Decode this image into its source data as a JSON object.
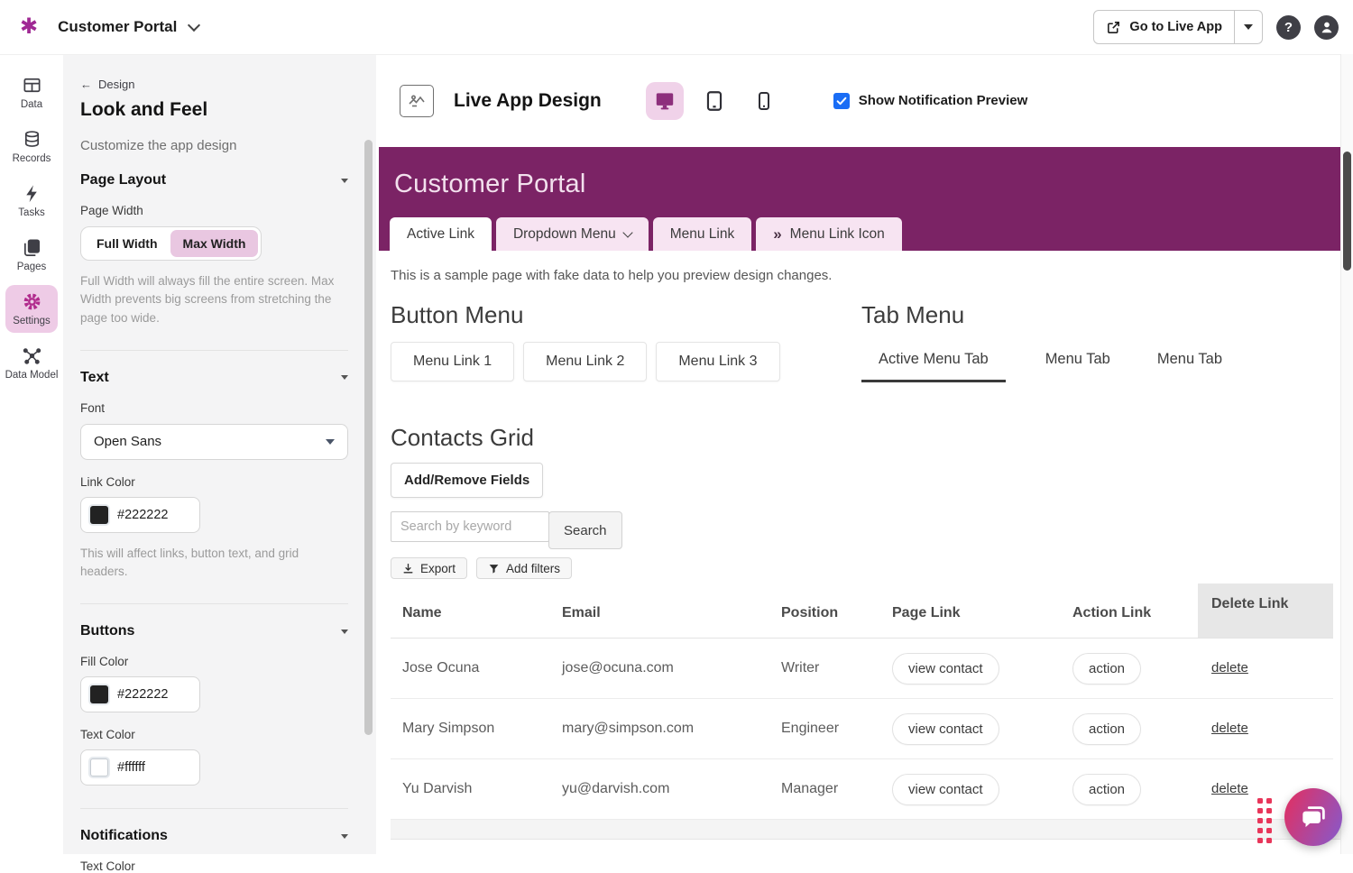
{
  "icons": {
    "logo": "✱",
    "back_arrow": "←",
    "double_chevron": "»",
    "help": "?"
  },
  "topbar": {
    "app_title": "Customer Portal",
    "go_live_label": "Go to Live App"
  },
  "sidebar": {
    "items": [
      {
        "label": "Data"
      },
      {
        "label": "Records"
      },
      {
        "label": "Tasks"
      },
      {
        "label": "Pages"
      },
      {
        "label": "Settings"
      },
      {
        "label": "Data Model"
      }
    ]
  },
  "panel": {
    "back_label": "Design",
    "title": "Look and Feel",
    "subtitle": "Customize the app design",
    "page_layout": {
      "heading": "Page Layout",
      "page_width_label": "Page Width",
      "full_width": "Full Width",
      "max_width": "Max Width",
      "helper": "Full Width will always fill the entire screen. Max Width prevents big screens from stretching the page too wide."
    },
    "text": {
      "heading": "Text",
      "font_label": "Font",
      "font_value": "Open Sans",
      "link_color_label": "Link Color",
      "link_color_value": "#222222",
      "helper": "This will affect links, button text, and grid headers."
    },
    "buttons": {
      "heading": "Buttons",
      "fill_color_label": "Fill Color",
      "fill_color_value": "#222222",
      "text_color_label": "Text Color",
      "text_color_value": "#ffffff"
    },
    "notifications": {
      "heading": "Notifications",
      "text_color_label": "Text Color"
    }
  },
  "main": {
    "title": "Live App Design",
    "notification_label": "Show Notification Preview",
    "preview": {
      "header_title": "Customer Portal",
      "nav_tabs": [
        {
          "label": "Active Link"
        },
        {
          "label": "Dropdown Menu"
        },
        {
          "label": "Menu Link"
        },
        {
          "label": "Menu Link Icon"
        }
      ],
      "sample_text": "This is a sample page with fake data to help you preview design changes.",
      "button_menu_heading": "Button Menu",
      "menu_buttons": [
        {
          "label": "Menu Link 1"
        },
        {
          "label": "Menu Link 2"
        },
        {
          "label": "Menu Link 3"
        }
      ],
      "tab_menu_heading": "Tab Menu",
      "menu_tabs": [
        {
          "label": "Active Menu Tab"
        },
        {
          "label": "Menu Tab"
        },
        {
          "label": "Menu Tab"
        }
      ],
      "contacts": {
        "heading": "Contacts Grid",
        "add_remove_label": "Add/Remove Fields",
        "search_placeholder": "Search by keyword",
        "search_label": "Search",
        "export_label": "Export",
        "add_filters_label": "Add filters",
        "table": {
          "columns": [
            {
              "label": "Name"
            },
            {
              "label": "Email"
            },
            {
              "label": "Position"
            },
            {
              "label": "Page Link"
            },
            {
              "label": "Action Link"
            },
            {
              "label": "Delete Link"
            }
          ],
          "rows": [
            {
              "name": "Jose Ocuna",
              "email": "jose@ocuna.com",
              "position": "Writer",
              "page_link": "view contact",
              "action_link": "action",
              "delete": "delete"
            },
            {
              "name": "Mary Simpson",
              "email": "mary@simpson.com",
              "position": "Engineer",
              "page_link": "view contact",
              "action_link": "action",
              "delete": "delete"
            },
            {
              "name": "Yu Darvish",
              "email": "yu@darvish.com",
              "position": "Manager",
              "page_link": "view contact",
              "action_link": "action",
              "delete": "delete"
            }
          ]
        }
      }
    }
  },
  "colors": {
    "header_purple": "#7b2365",
    "tab_pink": "#f7e4f2",
    "selected_pink": "#e9c7e1",
    "sidebar_active_pink": "#eecbe6",
    "gear_magenta": "#b12b8d",
    "checkbox_blue": "#1a6df5",
    "dots_red": "#e8365a",
    "chat_gradient_start": "#d6356f",
    "chat_gradient_end": "#9055c0"
  }
}
